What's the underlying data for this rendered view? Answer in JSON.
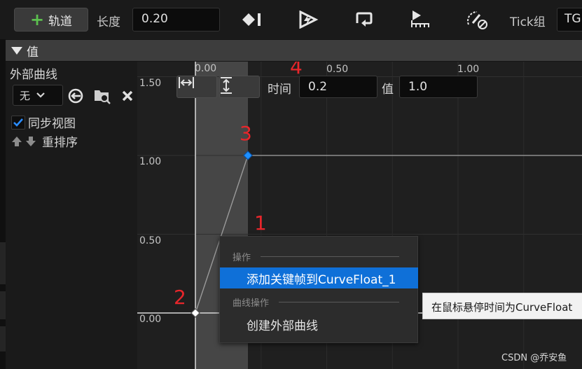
{
  "toolbar": {
    "add_track_label": "轨道",
    "length_label": "长度",
    "length_value": "0.20",
    "tick_group_label": "Tick组",
    "tick_group_value": "TG"
  },
  "section": {
    "title": "值"
  },
  "left_panel": {
    "external_curve_label": "外部曲线",
    "curve_select_value": "无",
    "sync_view_label": "同步视图",
    "sync_view_checked": true,
    "reorder_label": "重排序"
  },
  "graph": {
    "x_ticks": [
      "0.00",
      "0.50",
      "1.00"
    ],
    "y_ticks": [
      "1.50",
      "1.00",
      "0.50",
      "0.00"
    ],
    "time_label": "时间",
    "time_value": "0.2",
    "value_label": "值",
    "value_value": "1.0",
    "keys": [
      {
        "time": 0.0,
        "value": 0.0,
        "selected": false
      },
      {
        "time": 0.2,
        "value": 1.0,
        "selected": true
      }
    ]
  },
  "annotations": [
    "1",
    "2",
    "3",
    "4"
  ],
  "context_menu": {
    "section_actions": "操作",
    "add_key_label": "添加关键帧到CurveFloat_1",
    "section_curve_actions": "曲线操作",
    "create_external_curve_label": "创建外部曲线"
  },
  "tooltip": {
    "text": "在鼠标悬停时间为CurveFloat"
  },
  "watermark": "CSDN @乔安鱼",
  "colors": {
    "accent": "#0f70d8",
    "selected_key": "#1e90ff",
    "annotation": "#e8262b",
    "add_green": "#5cc04f"
  }
}
